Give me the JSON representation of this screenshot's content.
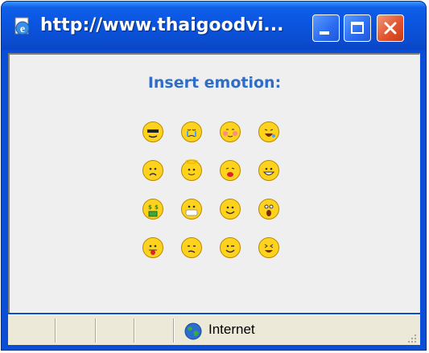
{
  "window": {
    "title": "http://www.thaigoodvi...",
    "icon": "ie-page-icon",
    "buttons": [
      "minimize",
      "maximize",
      "close"
    ],
    "colors": {
      "titlebar": "#0b4ed6",
      "close": "#e2542e"
    }
  },
  "content": {
    "heading": "Insert emotion:",
    "heading_color": "#2f6dc7",
    "emotions": [
      "cool-sunglasses",
      "crying",
      "blushing",
      "laughing",
      "sad",
      "angel",
      "kiss",
      "grinning",
      "money-mouth",
      "mask",
      "smile",
      "surprised",
      "tongue-out",
      "confused",
      "wink",
      "squinting-laugh"
    ]
  },
  "statusbar": {
    "zone": "Internet",
    "zone_icon": "globe-icon"
  }
}
